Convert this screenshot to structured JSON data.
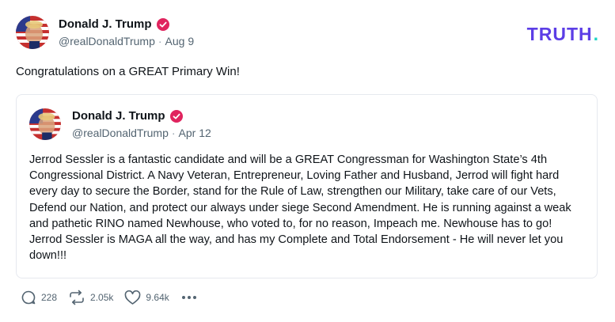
{
  "post": {
    "author_name": "Donald J. Trump",
    "handle": "@realDonaldTrump",
    "date": "Aug 9",
    "text": "Congratulations on a GREAT Primary Win!",
    "verified": true
  },
  "brand": {
    "text": "TRUTH",
    "dot": ".",
    "color": "#5c3ee6",
    "dot_color": "#1ed4c4"
  },
  "quote": {
    "author_name": "Donald J. Trump",
    "handle": "@realDonaldTrump",
    "date": "Apr 12",
    "verified": true,
    "text": "Jerrod Sessler is a fantastic candidate and will be a GREAT Congressman for Washington State’s 4th Congressional District. A Navy Veteran, Entrepreneur, Loving Father and Husband, Jerrod will fight hard every day to secure the Border, stand for the Rule of Law, strengthen our Military, take care of our Vets, Defend our Nation, and protect our always under siege Second Amendment. He is running against a weak and pathetic RINO named Newhouse, who voted to, for no reason, Impeach me. Newhouse has to go! Jerrod Sessler is MAGA all the way, and has my Complete and Total Endorsement - He will never let you down!!!"
  },
  "actions": {
    "replies": "228",
    "retruths": "2.05k",
    "likes": "9.64k"
  },
  "icons": {
    "verified": "verified-badge-icon",
    "reply": "comment-icon",
    "retruth": "retruth-icon",
    "like": "heart-icon",
    "more": "more-options-icon"
  },
  "colors": {
    "verified_badge": "#e0245e",
    "text_primary": "#0f1419",
    "text_secondary": "#536471"
  }
}
